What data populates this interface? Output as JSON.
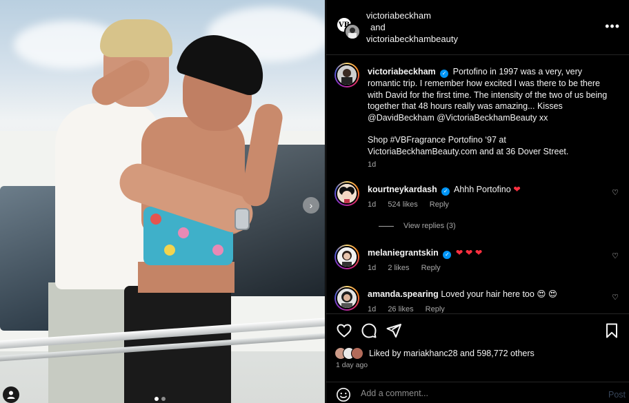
{
  "post": {
    "carousel": {
      "total_slides": 2,
      "active_slide": 1
    }
  },
  "header": {
    "author": "victoriabeckham",
    "and": "and",
    "collaborator": "victoriabeckhambeauty",
    "more_label": "•••"
  },
  "caption": {
    "username": "victoriabeckham",
    "text": "Portofino in 1997 was a very, very romantic trip. I remember how excited I was there to be there with David for the first time. The intensity of the two of us being together that 48 hours really was amazing... Kisses @DavidBeckham @VictoriaBeckhamBeauty xx",
    "text2": "Shop #VBFragrance Portofino ‘97 at VictoriaBeckhamBeauty.com and at 36 Dover Street.",
    "age": "1d"
  },
  "comments": [
    {
      "username": "kourtneykardash",
      "verified": true,
      "text": "Ahhh Portofino",
      "emoji": "❤",
      "age": "1d",
      "likes": "524 likes",
      "reply": "Reply",
      "view_replies": "View replies (3)"
    },
    {
      "username": "melaniegrantskin",
      "verified": true,
      "text": "",
      "emoji": "❤ ❤ ❤",
      "age": "1d",
      "likes": "2 likes",
      "reply": "Reply"
    },
    {
      "username": "amanda.spearing",
      "verified": false,
      "text": "Loved your hair here too",
      "emoji": "😍 😍",
      "age": "1d",
      "likes": "26 likes",
      "reply": "Reply"
    }
  ],
  "actions": {
    "liked_by_prefix": "Liked by",
    "liked_by_user": "mariakhanc28",
    "liked_by_and": "and",
    "liked_by_count": "598,772 others",
    "posted_ago": "1 day ago"
  },
  "add_comment": {
    "placeholder": "Add a comment...",
    "post_label": "Post"
  },
  "colors": {
    "background": "#000000",
    "verified": "#0095f6",
    "like_red": "#ff3040",
    "muted_text": "#a8a8a8",
    "post_disabled": "#38465a"
  }
}
